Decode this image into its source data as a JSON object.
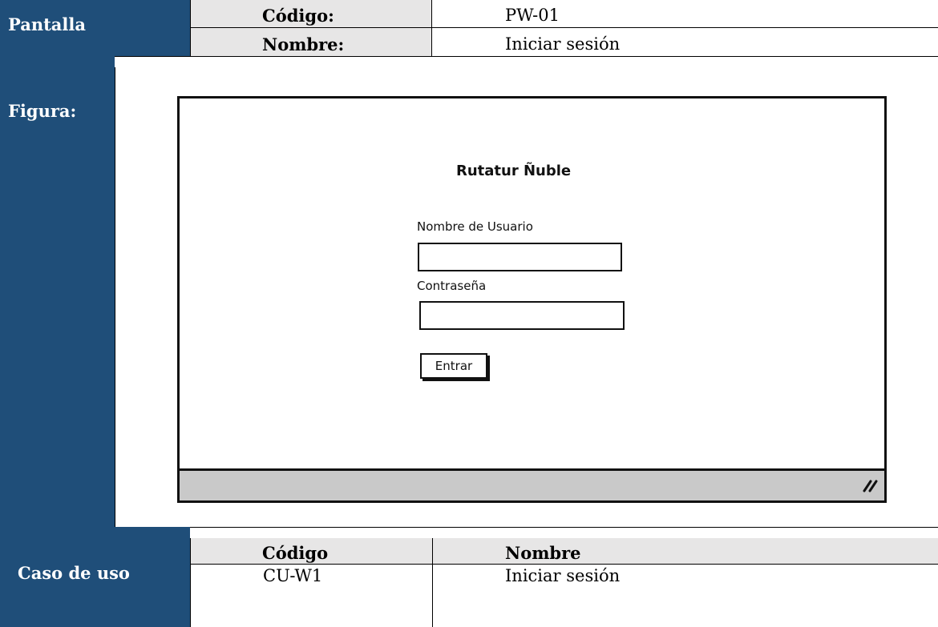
{
  "header": {
    "pantalla_label": "Pantalla",
    "codigo_label": "Código:",
    "codigo_value": "PW-01",
    "nombre_label": "Nombre:",
    "nombre_value": "Iniciar sesión"
  },
  "figure": {
    "label": "Figura:",
    "mockup": {
      "title": "Rutatur Ñuble",
      "username_label": "Nombre de Usuario",
      "username_value": "",
      "password_label": "Contraseña",
      "password_value": "",
      "submit_label": "Entrar",
      "resize_icon": "resize-grip-icon"
    }
  },
  "use_case": {
    "label": "Caso de uso",
    "col_codigo": "Código",
    "col_nombre": "Nombre",
    "rows": [
      {
        "codigo": "CU-W1",
        "nombre": "Iniciar sesión"
      }
    ]
  },
  "colors": {
    "header_navy": "#1f4e79",
    "header_grey": "#e7e6e6"
  }
}
